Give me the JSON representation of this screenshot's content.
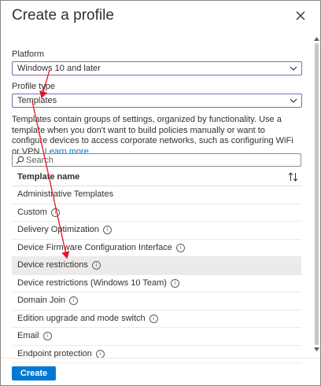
{
  "dialog": {
    "title": "Create a profile",
    "close_icon": "close-icon"
  },
  "platform": {
    "label": "Platform",
    "value": "Windows 10 and later"
  },
  "profile_type": {
    "label": "Profile type",
    "value": "Templates"
  },
  "description": {
    "text": "Templates contain groups of settings, organized by functionality. Use a template when you don't want to build policies manually or want to configure devices to access corporate networks, such as configuring WiFi or VPN.",
    "link": "Learn more"
  },
  "search": {
    "placeholder": "Search",
    "value": ""
  },
  "grid": {
    "column_header": "Template name",
    "sort_icon": "sort-updown-icon",
    "rows": [
      {
        "label": "Administrative Templates",
        "info": false,
        "selected": false
      },
      {
        "label": "Custom",
        "info": true,
        "selected": false
      },
      {
        "label": "Delivery Optimization",
        "info": true,
        "selected": false
      },
      {
        "label": "Device Firmware Configuration Interface",
        "info": true,
        "selected": false
      },
      {
        "label": "Device restrictions",
        "info": true,
        "selected": true
      },
      {
        "label": "Device restrictions (Windows 10 Team)",
        "info": true,
        "selected": false
      },
      {
        "label": "Domain Join",
        "info": true,
        "selected": false
      },
      {
        "label": "Edition upgrade and mode switch",
        "info": true,
        "selected": false
      },
      {
        "label": "Email",
        "info": true,
        "selected": false
      },
      {
        "label": "Endpoint protection",
        "info": true,
        "selected": false
      }
    ],
    "info_glyph": "i"
  },
  "footer": {
    "create_label": "Create"
  },
  "colors": {
    "accent": "#0078d4",
    "dropdown_border": "#8764b8",
    "annotation_arrow": "#e81123",
    "selected_row": "#edebe9"
  }
}
